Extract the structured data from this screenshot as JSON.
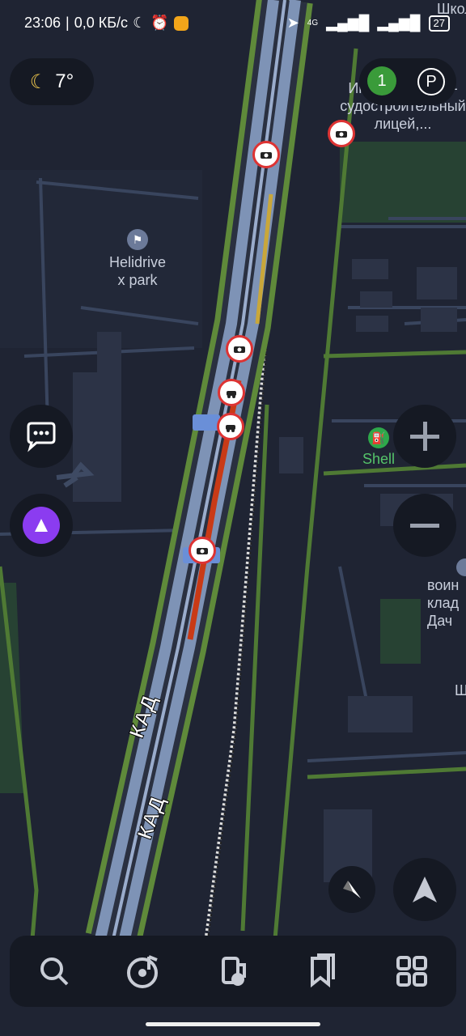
{
  "status_bar": {
    "time": "23:06",
    "speed": "0,0 КБ/с",
    "network": "4G",
    "battery": "27"
  },
  "weather": {
    "temperature": "7°"
  },
  "map_labels": {
    "helidrive": "Helidrive\nx park",
    "school_line1": "Индустриально-",
    "school_line2": "судостроительный",
    "school_line3": "лицей,...",
    "school_short": "Школ",
    "shell": "Shell",
    "cemetery1": "воин",
    "cemetery2": "клад",
    "cemetery3": "Дач",
    "short_sh": "Ш",
    "road1": "КАД",
    "road2": "КАД"
  },
  "top_right": {
    "alert_count": "1"
  },
  "colors": {
    "background": "#1f2433",
    "panel": "#151923",
    "road_green": "#5f8a3a",
    "road_blue": "#7e93b6",
    "traffic_red": "#c93a16",
    "traffic_yellow": "#c9a73a",
    "accent_purple": "#8b3cf0"
  }
}
